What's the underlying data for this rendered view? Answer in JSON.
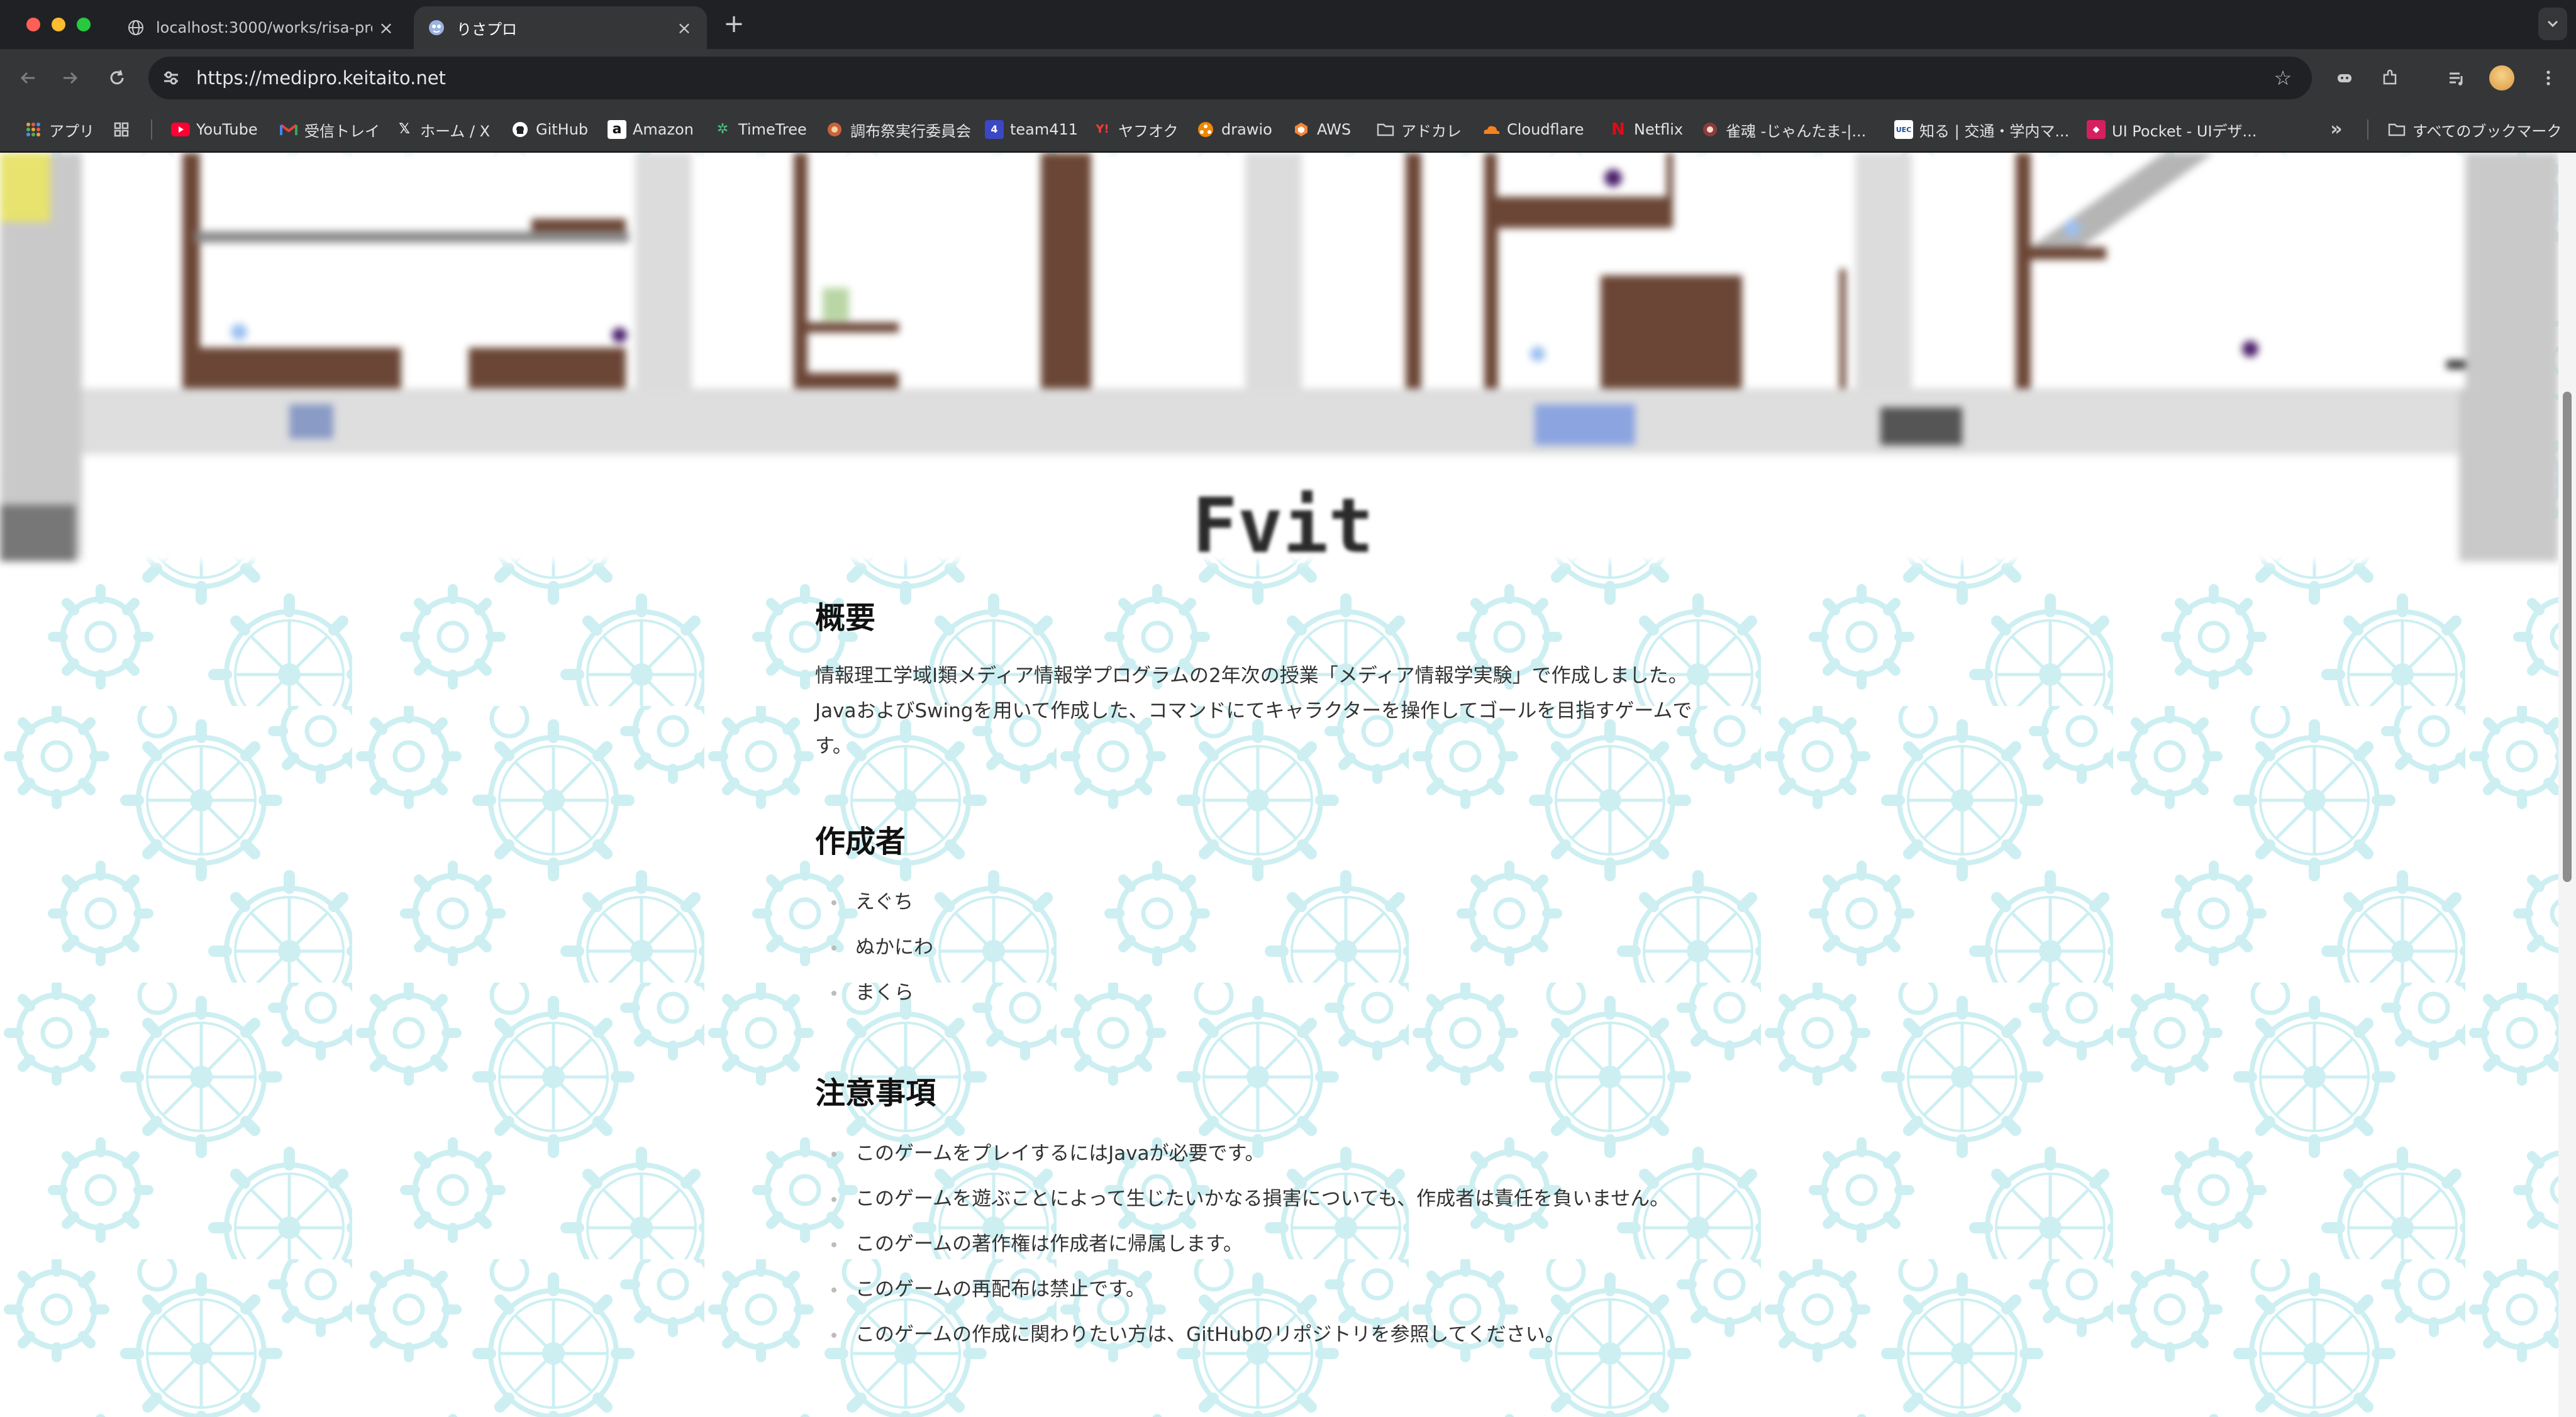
{
  "browser": {
    "tabs": [
      {
        "title": "localhost:3000/works/risa-pro",
        "favicon": "globe-icon",
        "active": false
      },
      {
        "title": "りさプロ",
        "favicon": "site-logo-icon",
        "active": true
      }
    ],
    "url": "https://medipro.keitaito.net",
    "bookmarks": [
      {
        "label": "アプリ",
        "icon": "apps-grid-icon"
      },
      {
        "label": "YouTube",
        "icon": "youtube-icon"
      },
      {
        "label": "受信トレイ",
        "icon": "gmail-icon"
      },
      {
        "label": "ホーム / X",
        "icon": "x-icon"
      },
      {
        "label": "GitHub",
        "icon": "github-icon"
      },
      {
        "label": "Amazon",
        "icon": "amazon-icon"
      },
      {
        "label": "TimeTree",
        "icon": "timetree-icon"
      },
      {
        "label": "調布祭実行委員会",
        "icon": "chofusai-icon"
      },
      {
        "label": "team411",
        "icon": "team411-icon"
      },
      {
        "label": "ヤフオク",
        "icon": "yahoo-auction-icon"
      },
      {
        "label": "drawio",
        "icon": "drawio-icon"
      },
      {
        "label": "AWS",
        "icon": "aws-icon"
      },
      {
        "label": "アドカレ",
        "icon": "folder-icon"
      },
      {
        "label": "Cloudflare",
        "icon": "cloudflare-icon"
      },
      {
        "label": "Netflix",
        "icon": "netflix-icon"
      },
      {
        "label": "雀魂 -じゃんたま-|...",
        "icon": "mahjongsoul-icon"
      },
      {
        "label": "知る | 交通・学内マ...",
        "icon": "uec-icon"
      },
      {
        "label": "UI Pocket - UIデザ...",
        "icon": "uipocket-icon"
      }
    ],
    "all_bookmarks_label": "すべてのブックマーク"
  },
  "page": {
    "hero_title": "Fvit",
    "sections": [
      {
        "heading": "概要",
        "paragraph": [
          "情報理工学域I類メディア情報学プログラムの2年次の授業「メディア情報学実験」で作成しました。",
          "JavaおよびSwingを用いて作成した、コマンドにてキャラクターを操作してゴールを目指すゲームで",
          "す。"
        ]
      },
      {
        "heading": "作成者",
        "items": [
          "えぐち",
          "ぬかにわ",
          "まくら"
        ]
      },
      {
        "heading": "注意事項",
        "items": [
          "このゲームをプレイするにはJavaが必要です。",
          "このゲームを遊ぶことによって生じたいかなる損害についても、作成者は責任を負いません。",
          "このゲームの著作権は作成者に帰属します。",
          "このゲームの再配布は禁止です。",
          "このゲームの作成に関わりたい方は、GitHubのリポジトリを参照してください。"
        ]
      }
    ]
  },
  "colors": {
    "gear_pattern": "#cdeff2",
    "brick": "#6b4636",
    "chrome_dark": "#202124",
    "chrome_toolbar": "#353638"
  }
}
